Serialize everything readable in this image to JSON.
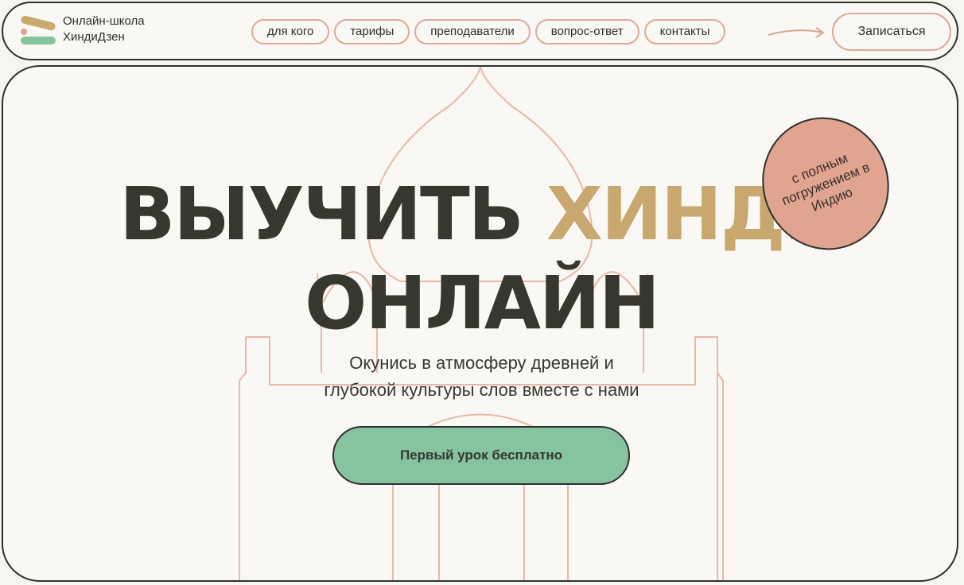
{
  "header": {
    "logo_line1": "Онлайн-школа",
    "logo_line2": "ХиндиДзен",
    "nav": [
      "для кого",
      "тарифы",
      "преподаватели",
      "вопрос-ответ",
      "контакты"
    ],
    "signup_label": "Записаться"
  },
  "hero": {
    "title_word1": "ВЫУЧИТЬ",
    "title_word2": "ХИНДИ",
    "title_line2": "ОНЛАЙН",
    "badge": "с полным погружением в Индию",
    "subtitle_line1": "Окунись в атмосферу древней и",
    "subtitle_line2": "глубокой культуры слов вместе с нами",
    "cta_label": "Первый урок бесплатно"
  },
  "colors": {
    "background": "#f7f5f0",
    "outline": "#2f2f2f",
    "accent_gold": "#c8a86e",
    "accent_pink": "#e0a490",
    "accent_green": "#86c39f",
    "line_pink": "#e8b8a8"
  },
  "icons": [
    "logo-icon",
    "arrow-right-icon"
  ]
}
